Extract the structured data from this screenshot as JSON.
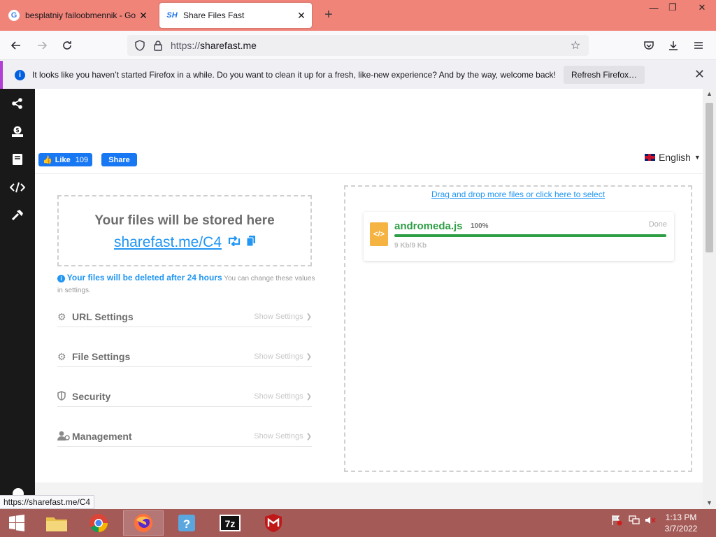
{
  "browser": {
    "tabs": [
      {
        "title": "besplatniy failoobmennik - Goo",
        "favicon": "google-g-icon",
        "active": false
      },
      {
        "title": "Share Files Fast",
        "favicon": "sharefast-logo-icon",
        "active": true
      }
    ],
    "url_prefix": "https://",
    "url_domain": "sharefast.me"
  },
  "notification": {
    "message": "It looks like you haven’t started Firefox in a while. Do you want to clean it up for a fresh, like-new experience? And by the way, welcome back!",
    "button": "Refresh Firefox…"
  },
  "page": {
    "facebook": {
      "like_label": "Like",
      "like_count": "109",
      "share_label": "Share"
    },
    "language": "English",
    "store": {
      "title": "Your files will be stored here",
      "link": "sharefast.me/C4"
    },
    "note": {
      "strong": "Your files will be deleted after 24 hours",
      "rest": " You can change these values in settings."
    },
    "settings": [
      {
        "title": "URL Settings",
        "icon": "cogs-icon",
        "show": "Show Settings"
      },
      {
        "title": "File Settings",
        "icon": "cogs-icon",
        "show": "Show Settings"
      },
      {
        "title": "Security",
        "icon": "shield-icon",
        "show": "Show Settings"
      },
      {
        "title": "Management",
        "icon": "user-cog-icon",
        "show": "Show Settings"
      }
    ],
    "dropzone": {
      "link": "Drag and drop more files or click here to select",
      "file": {
        "name": "andromeda.js",
        "percent": "100%",
        "progress": 1.0,
        "status": "Done",
        "size": "9 Kb/9 Kb"
      }
    }
  },
  "status_url": "https://sharefast.me/C4",
  "taskbar": {
    "time": "1:13 PM",
    "date": "3/7/2022"
  },
  "colors": {
    "accent": "#2196f3",
    "success": "#2e9e45",
    "titlebar": "#f08479",
    "taskbar": "#a45a57"
  }
}
